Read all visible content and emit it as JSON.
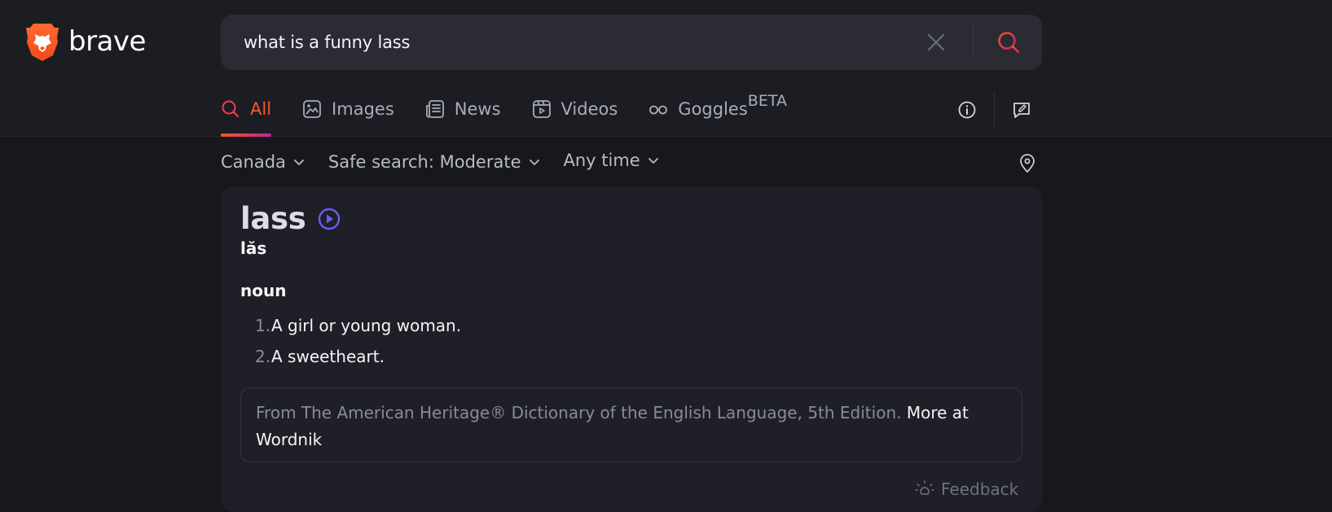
{
  "brand": {
    "name": "brave",
    "accent": "#f15a24",
    "accent_gradient_end": "#c6209a",
    "logo_icon": "brave-lion-icon"
  },
  "search": {
    "query": "what is a funny lass",
    "clear_icon": "close-icon",
    "submit_icon": "search-icon"
  },
  "tabs": [
    {
      "label": "All",
      "icon": "search-icon",
      "active": true
    },
    {
      "label": "Images",
      "icon": "image-icon",
      "active": false
    },
    {
      "label": "News",
      "icon": "newspaper-icon",
      "active": false
    },
    {
      "label": "Videos",
      "icon": "video-icon",
      "active": false
    },
    {
      "label": "Goggles",
      "badge": "BETA",
      "icon": "goggles-icon",
      "active": false
    }
  ],
  "header_actions": [
    {
      "icon": "info-icon"
    },
    {
      "icon": "feedback-edit-icon"
    }
  ],
  "filters": {
    "region": "Canada",
    "safe_search": "Safe search: Moderate",
    "time": "Any time",
    "location_icon": "location-pin-icon"
  },
  "definition": {
    "word": "lass",
    "pronunciation": "lăs",
    "part_of_speech": "noun",
    "senses": [
      {
        "number": "1.",
        "text": "A girl or young woman."
      },
      {
        "number": "2.",
        "text": "A sweetheart."
      }
    ],
    "source_text": "From The American Heritage® Dictionary of the English Language, 5th Edition.",
    "more_link": "More at Wordnik",
    "play_color": "#6a5cf0"
  },
  "feedback": {
    "label": "Feedback"
  }
}
